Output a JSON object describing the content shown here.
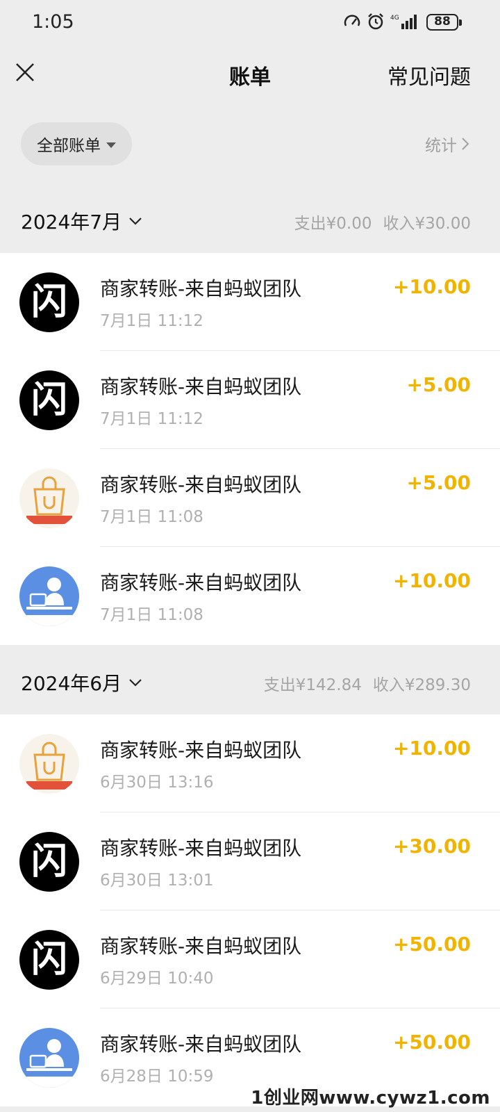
{
  "status_bar": {
    "time": "1:05",
    "battery": "88"
  },
  "header": {
    "title": "账单",
    "faq": "常见问题"
  },
  "filter": {
    "label": "全部账单",
    "stats": "统计"
  },
  "months": [
    {
      "label": "2024年7月",
      "summary_out": "支出¥0.00",
      "summary_in": "收入¥30.00",
      "items": [
        {
          "avatar": "flash-icon",
          "avatar_text": "闪",
          "title": "商家转账-来自蚂蚁团队",
          "time": "7月1日 11:12",
          "amount": "+10.00"
        },
        {
          "avatar": "flash-icon",
          "avatar_text": "闪",
          "title": "商家转账-来自蚂蚁团队",
          "time": "7月1日 11:12",
          "amount": "+5.00"
        },
        {
          "avatar": "shopping-bag-icon",
          "avatar_text": "",
          "title": "商家转账-来自蚂蚁团队",
          "time": "7月1日 11:08",
          "amount": "+5.00"
        },
        {
          "avatar": "person-desk-icon",
          "avatar_text": "",
          "title": "商家转账-来自蚂蚁团队",
          "time": "7月1日 11:08",
          "amount": "+10.00"
        }
      ]
    },
    {
      "label": "2024年6月",
      "summary_out": "支出¥142.84",
      "summary_in": "收入¥289.30",
      "items": [
        {
          "avatar": "shopping-bag-icon",
          "avatar_text": "",
          "title": "商家转账-来自蚂蚁团队",
          "time": "6月30日 13:16",
          "amount": "+10.00"
        },
        {
          "avatar": "flash-icon",
          "avatar_text": "闪",
          "title": "商家转账-来自蚂蚁团队",
          "time": "6月30日 13:01",
          "amount": "+30.00"
        },
        {
          "avatar": "flash-icon",
          "avatar_text": "闪",
          "title": "商家转账-来自蚂蚁团队",
          "time": "6月29日 10:40",
          "amount": "+50.00"
        },
        {
          "avatar": "person-desk-icon",
          "avatar_text": "",
          "title": "商家转账-来自蚂蚁团队",
          "time": "6月28日 10:59",
          "amount": "+50.00"
        }
      ]
    }
  ],
  "watermark": "1创业网www.cywz1.com",
  "colors": {
    "amount": "#f0b400",
    "background": "#ededed",
    "list_bg": "#ffffff"
  }
}
